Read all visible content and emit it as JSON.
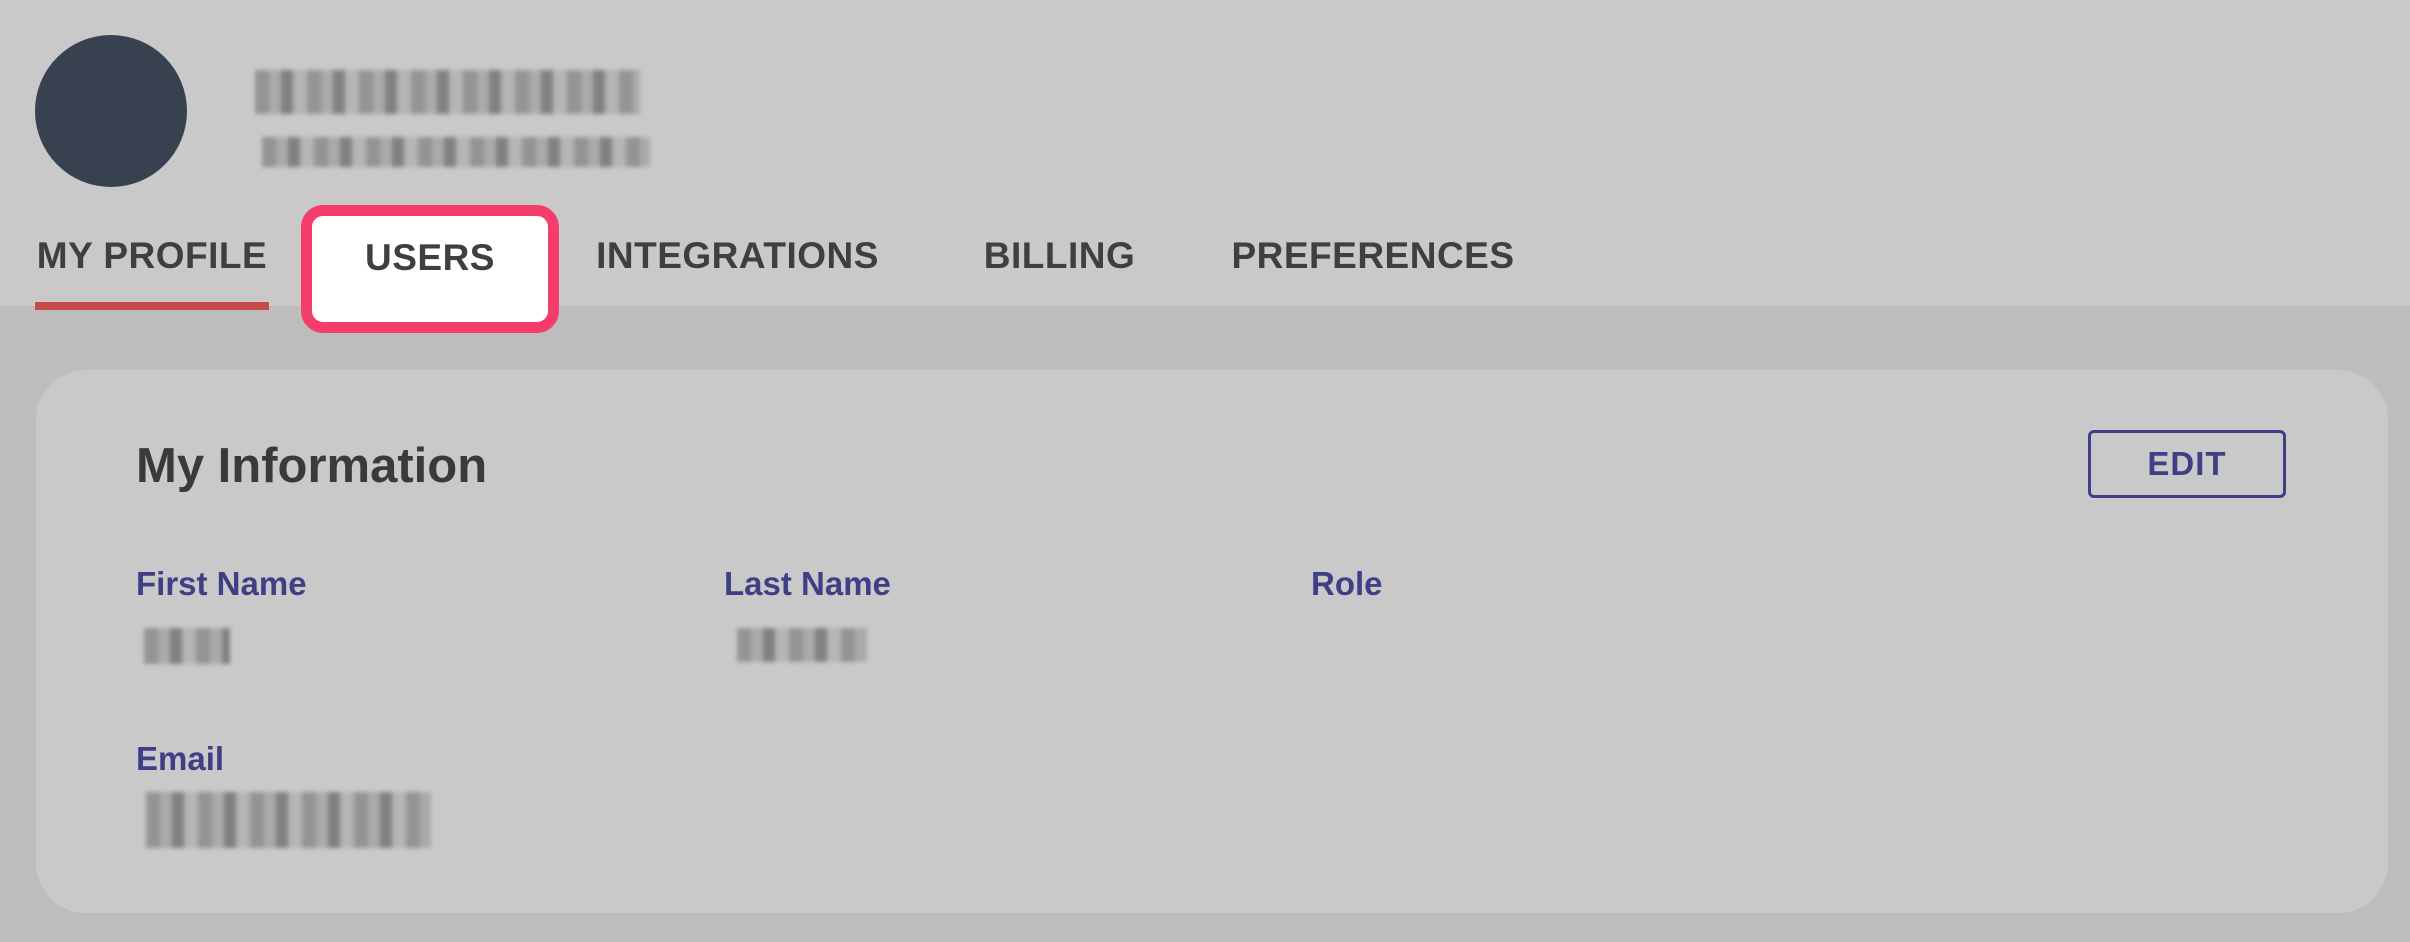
{
  "tabs": [
    {
      "label": "MY PROFILE",
      "active": true
    },
    {
      "label": "USERS",
      "highlighted": true
    },
    {
      "label": "INTEGRATIONS"
    },
    {
      "label": "BILLING"
    },
    {
      "label": "PREFERENCES"
    }
  ],
  "card": {
    "title": "My Information",
    "edit_label": "EDIT",
    "fields": {
      "first_name_label": "First Name",
      "last_name_label": "Last Name",
      "role_label": "Role",
      "email_label": "Email"
    }
  },
  "colors": {
    "accent_label": "#3f3f86",
    "active_tab_underline": "#c94a4a",
    "highlight_border": "#f53d6b",
    "avatar": "#374150"
  },
  "icons": {
    "avatar": "avatar-circle"
  }
}
